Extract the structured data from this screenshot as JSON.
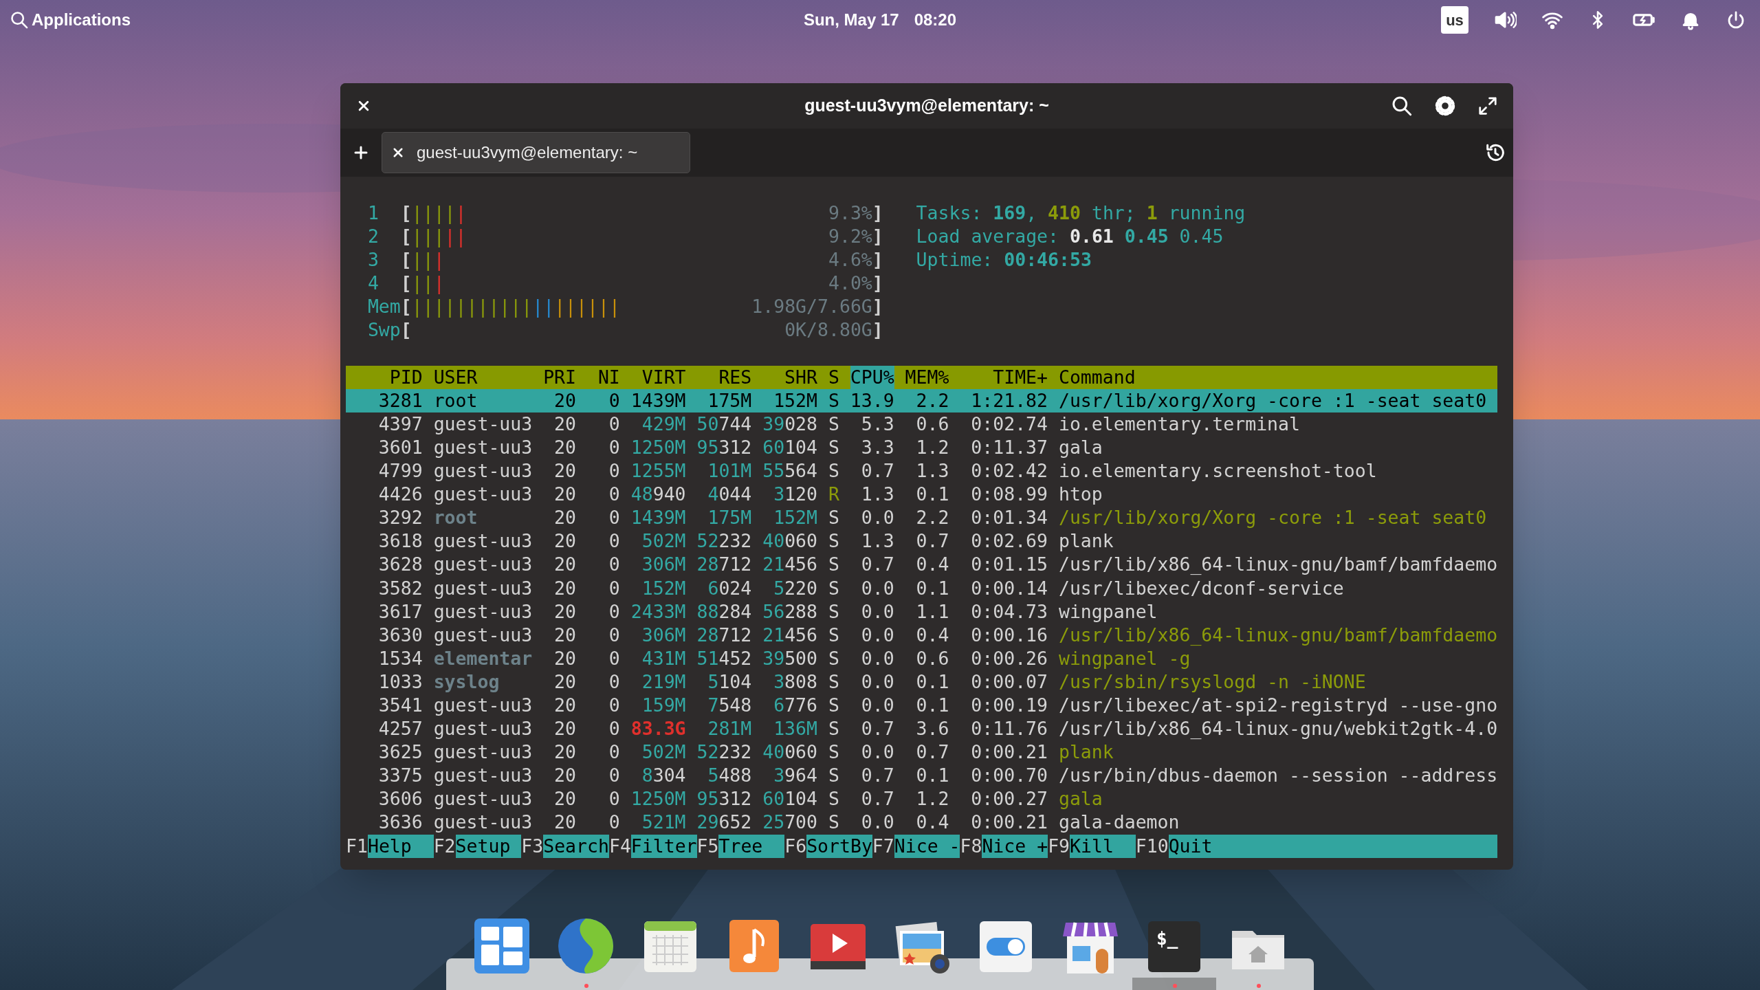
{
  "top_panel": {
    "applications": "Applications",
    "date": "Sun, May 17",
    "time": "08:20",
    "keyboard_layout": "us"
  },
  "window": {
    "title": "guest-uu3vym@elementary: ~",
    "tabs": [
      {
        "label": "guest-uu3vym@elementary: ~",
        "selected": true
      }
    ]
  },
  "htop": {
    "meters": [
      {
        "label": "1",
        "open": "[",
        "segments": [
          {
            "text": "||||",
            "color": "#8c9c0a"
          },
          {
            "text": "|",
            "color": "#e0302c"
          }
        ],
        "reading": "9.3%",
        "close": "]"
      },
      {
        "label": "2",
        "open": "[",
        "segments": [
          {
            "text": "|||",
            "color": "#8c9c0a"
          },
          {
            "text": "||",
            "color": "#e0302c"
          }
        ],
        "reading": "9.2%",
        "close": "]"
      },
      {
        "label": "3",
        "open": "[",
        "segments": [
          {
            "text": "||",
            "color": "#8c9c0a"
          },
          {
            "text": "|",
            "color": "#e0302c"
          }
        ],
        "reading": "4.6%",
        "close": "]"
      },
      {
        "label": "4",
        "open": "[",
        "segments": [
          {
            "text": "||",
            "color": "#8c9c0a"
          },
          {
            "text": "|",
            "color": "#e0302c"
          }
        ],
        "reading": "4.0%",
        "close": "]"
      },
      {
        "label": "Mem",
        "open": "[",
        "segments": [
          {
            "text": "|||||||||||",
            "color": "#8c9c0a"
          },
          {
            "text": "||",
            "color": "#268bd2"
          },
          {
            "text": "||||||",
            "color": "#c8900a"
          }
        ],
        "reading": "1.98G/7.66G",
        "close": "]"
      },
      {
        "label": "Swp",
        "open": "[",
        "reading": "0K/8.80G",
        "close": "]"
      }
    ],
    "summary": [
      {
        "parts": [
          {
            "text": "Tasks:",
            "kind": "label"
          },
          {
            "text": " 169",
            "kind": "value"
          },
          {
            "text": ",",
            "kind": "label"
          },
          {
            "text": " 410",
            "kind": "thread_value"
          },
          {
            "text": " thr;",
            "kind": "label"
          },
          {
            "text": " 1",
            "kind": "thread_value"
          },
          {
            "text": " running",
            "kind": "label"
          }
        ]
      },
      {
        "parts": [
          {
            "text": "Load average:",
            "kind": "label"
          },
          {
            "text": " 0.61",
            "kind": "load1"
          },
          {
            "text": " 0.45",
            "kind": "load5"
          },
          {
            "text": " 0.45",
            "kind": "load15"
          }
        ]
      },
      {
        "parts": [
          {
            "text": "Uptime:",
            "kind": "label"
          },
          {
            "text": " 00:46:53",
            "kind": "value"
          }
        ]
      }
    ],
    "columns": [
      {
        "label": "PID",
        "sorted": false
      },
      {
        "label": "USER",
        "sorted": false
      },
      {
        "label": "PRI",
        "sorted": false
      },
      {
        "label": "NI",
        "sorted": false
      },
      {
        "label": "VIRT",
        "sorted": false
      },
      {
        "label": "RES",
        "sorted": false
      },
      {
        "label": "SHR",
        "sorted": false
      },
      {
        "label": "S",
        "sorted": false
      },
      {
        "label": "CPU%",
        "sorted": true
      },
      {
        "label": "MEM%",
        "sorted": false
      },
      {
        "label": "TIME+",
        "sorted": false
      },
      {
        "label": "Command",
        "sorted": false
      }
    ],
    "rows": [
      {
        "pid": "3281",
        "user": "root",
        "pri": "20",
        "ni": "0",
        "virt": "1439M",
        "res": "175M",
        "shr": "152M",
        "s": "S",
        "cpu": "13.9",
        "mem": "2.2",
        "time": "1:21.82",
        "command": "/usr/lib/xorg/Xorg -core :1 -seat seat0",
        "selected": true,
        "thread": false,
        "other_user": true,
        "running": false
      },
      {
        "pid": "4397",
        "user": "guest-uu3",
        "pri": "20",
        "ni": "0",
        "virt": "429M",
        "res": "50744",
        "shr": "39028",
        "s": "S",
        "cpu": "5.3",
        "mem": "0.6",
        "time": "0:02.74",
        "command": "io.elementary.terminal",
        "selected": false,
        "thread": false,
        "other_user": false,
        "running": false
      },
      {
        "pid": "3601",
        "user": "guest-uu3",
        "pri": "20",
        "ni": "0",
        "virt": "1250M",
        "res": "95312",
        "shr": "60104",
        "s": "S",
        "cpu": "3.3",
        "mem": "1.2",
        "time": "0:11.37",
        "command": "gala",
        "selected": false,
        "thread": false,
        "other_user": false,
        "running": false
      },
      {
        "pid": "4799",
        "user": "guest-uu3",
        "pri": "20",
        "ni": "0",
        "virt": "1255M",
        "res": "101M",
        "shr": "55564",
        "s": "S",
        "cpu": "0.7",
        "mem": "1.3",
        "time": "0:02.42",
        "command": "io.elementary.screenshot-tool",
        "selected": false,
        "thread": false,
        "other_user": false,
        "running": false
      },
      {
        "pid": "4426",
        "user": "guest-uu3",
        "pri": "20",
        "ni": "0",
        "virt": "48940",
        "res": "4044",
        "shr": "3120",
        "s": "R",
        "cpu": "1.3",
        "mem": "0.1",
        "time": "0:08.99",
        "command": "htop",
        "selected": false,
        "thread": false,
        "other_user": false,
        "running": true
      },
      {
        "pid": "3292",
        "user": "root",
        "pri": "20",
        "ni": "0",
        "virt": "1439M",
        "res": "175M",
        "shr": "152M",
        "s": "S",
        "cpu": "0.0",
        "mem": "2.2",
        "time": "0:01.34",
        "command": "/usr/lib/xorg/Xorg -core :1 -seat seat0",
        "selected": false,
        "thread": true,
        "other_user": true,
        "running": false
      },
      {
        "pid": "3618",
        "user": "guest-uu3",
        "pri": "20",
        "ni": "0",
        "virt": "502M",
        "res": "52232",
        "shr": "40060",
        "s": "S",
        "cpu": "1.3",
        "mem": "0.7",
        "time": "0:02.69",
        "command": "plank",
        "selected": false,
        "thread": false,
        "other_user": false,
        "running": false
      },
      {
        "pid": "3628",
        "user": "guest-uu3",
        "pri": "20",
        "ni": "0",
        "virt": "306M",
        "res": "28712",
        "shr": "21456",
        "s": "S",
        "cpu": "0.7",
        "mem": "0.4",
        "time": "0:01.15",
        "command": "/usr/lib/x86_64-linux-gnu/bamf/bamfdaemo",
        "selected": false,
        "thread": false,
        "other_user": false,
        "running": false
      },
      {
        "pid": "3582",
        "user": "guest-uu3",
        "pri": "20",
        "ni": "0",
        "virt": "152M",
        "res": "6024",
        "shr": "5220",
        "s": "S",
        "cpu": "0.0",
        "mem": "0.1",
        "time": "0:00.14",
        "command": "/usr/libexec/dconf-service",
        "selected": false,
        "thread": false,
        "other_user": false,
        "running": false
      },
      {
        "pid": "3617",
        "user": "guest-uu3",
        "pri": "20",
        "ni": "0",
        "virt": "2433M",
        "res": "88284",
        "shr": "56288",
        "s": "S",
        "cpu": "0.0",
        "mem": "1.1",
        "time": "0:04.73",
        "command": "wingpanel",
        "selected": false,
        "thread": false,
        "other_user": false,
        "running": false
      },
      {
        "pid": "3630",
        "user": "guest-uu3",
        "pri": "20",
        "ni": "0",
        "virt": "306M",
        "res": "28712",
        "shr": "21456",
        "s": "S",
        "cpu": "0.0",
        "mem": "0.4",
        "time": "0:00.16",
        "command": "/usr/lib/x86_64-linux-gnu/bamf/bamfdaemo",
        "selected": false,
        "thread": true,
        "other_user": false,
        "running": false
      },
      {
        "pid": "1534",
        "user": "elementar",
        "pri": "20",
        "ni": "0",
        "virt": "431M",
        "res": "51452",
        "shr": "39500",
        "s": "S",
        "cpu": "0.0",
        "mem": "0.6",
        "time": "0:00.26",
        "command": "wingpanel -g",
        "selected": false,
        "thread": true,
        "other_user": true,
        "running": false
      },
      {
        "pid": "1033",
        "user": "syslog",
        "pri": "20",
        "ni": "0",
        "virt": "219M",
        "res": "5104",
        "shr": "3808",
        "s": "S",
        "cpu": "0.0",
        "mem": "0.1",
        "time": "0:00.07",
        "command": "/usr/sbin/rsyslogd -n -iNONE",
        "selected": false,
        "thread": true,
        "other_user": true,
        "running": false
      },
      {
        "pid": "3541",
        "user": "guest-uu3",
        "pri": "20",
        "ni": "0",
        "virt": "159M",
        "res": "7548",
        "shr": "6776",
        "s": "S",
        "cpu": "0.0",
        "mem": "0.1",
        "time": "0:00.19",
        "command": "/usr/libexec/at-spi2-registryd --use-gno",
        "selected": false,
        "thread": false,
        "other_user": false,
        "running": false
      },
      {
        "pid": "4257",
        "user": "guest-uu3",
        "pri": "20",
        "ni": "0",
        "virt": "83.3G",
        "res": "281M",
        "shr": "136M",
        "s": "S",
        "cpu": "0.7",
        "mem": "3.6",
        "time": "0:11.76",
        "command": "/usr/lib/x86_64-linux-gnu/webkit2gtk-4.0",
        "selected": false,
        "thread": false,
        "other_user": false,
        "running": false
      },
      {
        "pid": "3625",
        "user": "guest-uu3",
        "pri": "20",
        "ni": "0",
        "virt": "502M",
        "res": "52232",
        "shr": "40060",
        "s": "S",
        "cpu": "0.0",
        "mem": "0.7",
        "time": "0:00.21",
        "command": "plank",
        "selected": false,
        "thread": true,
        "other_user": false,
        "running": false
      },
      {
        "pid": "3375",
        "user": "guest-uu3",
        "pri": "20",
        "ni": "0",
        "virt": "8304",
        "res": "5488",
        "shr": "3964",
        "s": "S",
        "cpu": "0.7",
        "mem": "0.1",
        "time": "0:00.70",
        "command": "/usr/bin/dbus-daemon --session --address",
        "selected": false,
        "thread": false,
        "other_user": false,
        "running": false
      },
      {
        "pid": "3606",
        "user": "guest-uu3",
        "pri": "20",
        "ni": "0",
        "virt": "1250M",
        "res": "95312",
        "shr": "60104",
        "s": "S",
        "cpu": "0.7",
        "mem": "1.2",
        "time": "0:00.27",
        "command": "gala",
        "selected": false,
        "thread": true,
        "other_user": false,
        "running": false
      },
      {
        "pid": "3636",
        "user": "guest-uu3",
        "pri": "20",
        "ni": "0",
        "virt": "521M",
        "res": "29652",
        "shr": "25700",
        "s": "S",
        "cpu": "0.0",
        "mem": "0.4",
        "time": "0:00.21",
        "command": "gala-daemon",
        "selected": false,
        "thread": false,
        "other_user": false,
        "running": false
      }
    ],
    "function_keys": [
      {
        "key": "F1",
        "label": "Help"
      },
      {
        "key": "F2",
        "label": "Setup"
      },
      {
        "key": "F3",
        "label": "Search"
      },
      {
        "key": "F4",
        "label": "Filter"
      },
      {
        "key": "F5",
        "label": "Tree"
      },
      {
        "key": "F6",
        "label": "SortBy"
      },
      {
        "key": "F7",
        "label": "Nice -"
      },
      {
        "key": "F8",
        "label": "Nice +"
      },
      {
        "key": "F9",
        "label": "Kill"
      },
      {
        "key": "F10",
        "label": "Quit"
      }
    ]
  },
  "dock": [
    {
      "kind": "multitasking",
      "running": false,
      "focused": false
    },
    {
      "kind": "browser",
      "running": true,
      "focused": false
    },
    {
      "kind": "calendar",
      "running": false,
      "focused": false
    },
    {
      "kind": "music",
      "running": false,
      "focused": false
    },
    {
      "kind": "videos",
      "running": false,
      "focused": false
    },
    {
      "kind": "photos",
      "running": false,
      "focused": false
    },
    {
      "kind": "settings",
      "running": false,
      "focused": false
    },
    {
      "kind": "appcenter",
      "running": false,
      "focused": false
    },
    {
      "kind": "terminal",
      "glyph": "$_",
      "running": true,
      "focused": true
    },
    {
      "kind": "files",
      "running": true,
      "focused": false
    }
  ]
}
